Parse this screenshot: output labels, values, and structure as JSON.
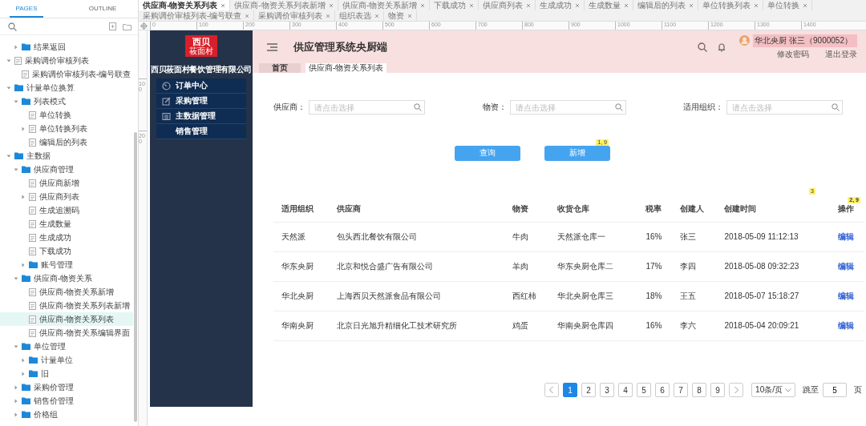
{
  "editor_tabs": [
    {
      "label": "供应商-物资关系列表",
      "selected": true
    },
    {
      "label": "供应商-物资关系列表新增",
      "selected": false
    },
    {
      "label": "供应商-物资关系新增",
      "selected": false
    },
    {
      "label": "下载成功",
      "selected": false
    },
    {
      "label": "供应商列表",
      "selected": false
    },
    {
      "label": "生成成功",
      "selected": false
    },
    {
      "label": "生成数量",
      "selected": false
    },
    {
      "label": "编辑后的列表",
      "selected": false
    },
    {
      "label": "单位转换列表",
      "selected": false
    },
    {
      "label": "单位转换",
      "selected": false
    },
    {
      "label": "采购调价审核列表-编号联查",
      "selected": false
    },
    {
      "label": "采购调价审核列表",
      "selected": false
    },
    {
      "label": "组织表选",
      "selected": false
    },
    {
      "label": "物资",
      "selected": false
    }
  ],
  "left_panel": {
    "tabs": [
      {
        "label": "PAGES",
        "selected": true
      },
      {
        "label": "OUTLINE",
        "selected": false
      }
    ],
    "tree": {
      "continued": [
        {
          "label": "结果返回",
          "kind": "folder",
          "expanded": false,
          "selected": false
        }
      ],
      "items": [
        {
          "label": "采购调价审核列表",
          "kind": "page",
          "expanded": true,
          "selected": false,
          "children": [
            {
              "label": "采购调价审核列表-编号联查",
              "kind": "page",
              "selected": false
            }
          ]
        },
        {
          "label": "计量单位换算",
          "kind": "folder",
          "expanded": true,
          "selected": false,
          "children": [
            {
              "label": "列表模式",
              "kind": "folder",
              "expanded": true,
              "selected": false,
              "children": [
                {
                  "label": "单位转换",
                  "kind": "page",
                  "selected": false
                },
                {
                  "label": "单位转换列表",
                  "kind": "page",
                  "expanded": false,
                  "selected": false
                },
                {
                  "label": "编辑后的列表",
                  "kind": "page",
                  "selected": false
                }
              ]
            }
          ]
        },
        {
          "label": "主数据",
          "kind": "folder",
          "expanded": true,
          "selected": false,
          "children": [
            {
              "label": "供应商管理",
              "kind": "folder",
              "expanded": true,
              "selected": false,
              "children": [
                {
                  "label": "供应商新增",
                  "kind": "page",
                  "selected": false
                },
                {
                  "label": "供应商列表",
                  "kind": "page",
                  "expanded": false,
                  "selected": false
                },
                {
                  "label": "生成追溯码",
                  "kind": "page",
                  "selected": false
                },
                {
                  "label": "生成数量",
                  "kind": "page",
                  "selected": false
                },
                {
                  "label": "生成成功",
                  "kind": "page",
                  "selected": false
                },
                {
                  "label": "下载成功",
                  "kind": "page",
                  "selected": false
                },
                {
                  "label": "账号管理",
                  "kind": "folder",
                  "expanded": false,
                  "selected": false
                }
              ]
            },
            {
              "label": "供应商-物资关系",
              "kind": "folder",
              "expanded": true,
              "selected": false,
              "children": [
                {
                  "label": "供应商-物资关系新增",
                  "kind": "page",
                  "selected": false
                },
                {
                  "label": "供应商-物资关系列表新增",
                  "kind": "page",
                  "selected": false
                },
                {
                  "label": "供应商-物资关系列表",
                  "kind": "page",
                  "selected": true
                },
                {
                  "label": "供应商-物资关系编辑界面",
                  "kind": "page",
                  "selected": false
                }
              ]
            },
            {
              "label": "单位管理",
              "kind": "folder",
              "expanded": true,
              "selected": false,
              "children": [
                {
                  "label": "计量单位",
                  "kind": "folder",
                  "expanded": false,
                  "selected": false
                },
                {
                  "label": "旧",
                  "kind": "folder",
                  "expanded": false,
                  "selected": false
                }
              ]
            },
            {
              "label": "采购价管理",
              "kind": "folder",
              "expanded": false,
              "selected": false
            },
            {
              "label": "销售价管理",
              "kind": "folder",
              "expanded": false,
              "selected": false
            },
            {
              "label": "价格组",
              "kind": "folder",
              "expanded": false,
              "selected": false
            }
          ]
        }
      ]
    }
  },
  "ruler": {
    "horizontal": [
      "0",
      "100",
      "200",
      "300",
      "400",
      "500",
      "600",
      "700",
      "800",
      "900",
      "1000",
      "1100",
      "1200",
      "1300",
      "1400"
    ],
    "vertical": [
      "100",
      "200"
    ]
  },
  "prototype": {
    "logo": [
      "西贝",
      "莜面村"
    ],
    "company": "西贝莜面村餐饮管理有限公司",
    "nav": [
      {
        "label": "订单中心"
      },
      {
        "label": "采购管理"
      },
      {
        "label": "主数据管理"
      },
      {
        "label": "销售管理"
      }
    ],
    "header": {
      "title": "供应管理系统央厨端",
      "user": "华北央厨 张三（9000052）",
      "links": [
        "修改密码",
        "退出登录"
      ]
    },
    "breadcrumb": [
      {
        "label": "首页",
        "selected": false
      },
      {
        "label": "供应商-物资关系列表",
        "selected": true
      }
    ],
    "filters": [
      {
        "label": "供应商：",
        "placeholder": "请点击选择"
      },
      {
        "label": "物资：",
        "placeholder": "请点击选择"
      },
      {
        "label": "适用组织：",
        "placeholder": "请点击选择"
      }
    ],
    "buttons": [
      {
        "label": "查询"
      },
      {
        "label": "新增",
        "note": "1, 9"
      }
    ],
    "table": {
      "note": "3",
      "columns": [
        {
          "label": "适用组织"
        },
        {
          "label": "供应商"
        },
        {
          "label": "物资"
        },
        {
          "label": "收货仓库"
        },
        {
          "label": "税率"
        },
        {
          "label": "创建人"
        },
        {
          "label": "创建时间"
        },
        {
          "label": "操作",
          "note": "2, 9"
        }
      ],
      "rows": [
        [
          "天然派",
          "包头西北餐饮有限公司",
          "牛肉",
          "天然派仓库一",
          "16%",
          "张三",
          "2018-05-09 11:12:13",
          "编辑"
        ],
        [
          "华东央厨",
          "北京和悦合盛广告有限公司",
          "羊肉",
          "华东央厨仓库二",
          "17%",
          "李四",
          "2018-05-08 09:32:23",
          "编辑"
        ],
        [
          "华北央厨",
          "上海西贝天然派食品有限公司",
          "西红柿",
          "华北央厨仓库三",
          "18%",
          "王五",
          "2018-05-07 15:18:27",
          "编辑"
        ],
        [
          "华南央厨",
          "北京日光旭升精细化工技术研究所",
          "鸡蛋",
          "华南央厨仓库四",
          "16%",
          "李六",
          "2018-05-04 20:09:21",
          "编辑"
        ]
      ]
    },
    "pagination": {
      "pages": [
        {
          "label": "1",
          "selected": true
        },
        {
          "label": "2",
          "selected": false
        },
        {
          "label": "3",
          "selected": false
        },
        {
          "label": "4",
          "selected": false
        },
        {
          "label": "5",
          "selected": false
        },
        {
          "label": "6",
          "selected": false
        },
        {
          "label": "7",
          "selected": false
        },
        {
          "label": "8",
          "selected": false
        },
        {
          "label": "9",
          "selected": false
        }
      ],
      "page_size": "10条/页",
      "jump_label": "跳至",
      "jump_value": "5",
      "jump_suffix": "页"
    }
  }
}
